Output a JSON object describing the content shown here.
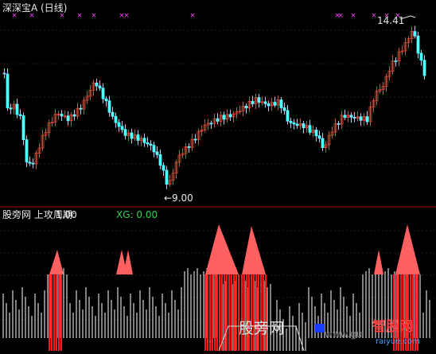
{
  "header": {
    "title": "深深宝A (日线)"
  },
  "price_panel": {
    "high_label": "14.41",
    "low_label": "←9.00",
    "colors": {
      "up": "#ff3c3c",
      "down": "#54ffff",
      "xg_mark": "#ff40ff",
      "grid": "#3a1414",
      "divider": "#b00000"
    }
  },
  "indicator_panel": {
    "label": "股旁网 上攻周期:",
    "value": "1.00",
    "xg": "XG: 0.00",
    "colors": {
      "bar": "#ffffff",
      "signal": "#ff1a1a",
      "peak": "#ff6060",
      "xg": "#33d455"
    }
  },
  "watermark": {
    "left": "股旁网",
    "middle": "www.gu",
    "logo": "智股网",
    "url": "raiyue.com"
  }
}
